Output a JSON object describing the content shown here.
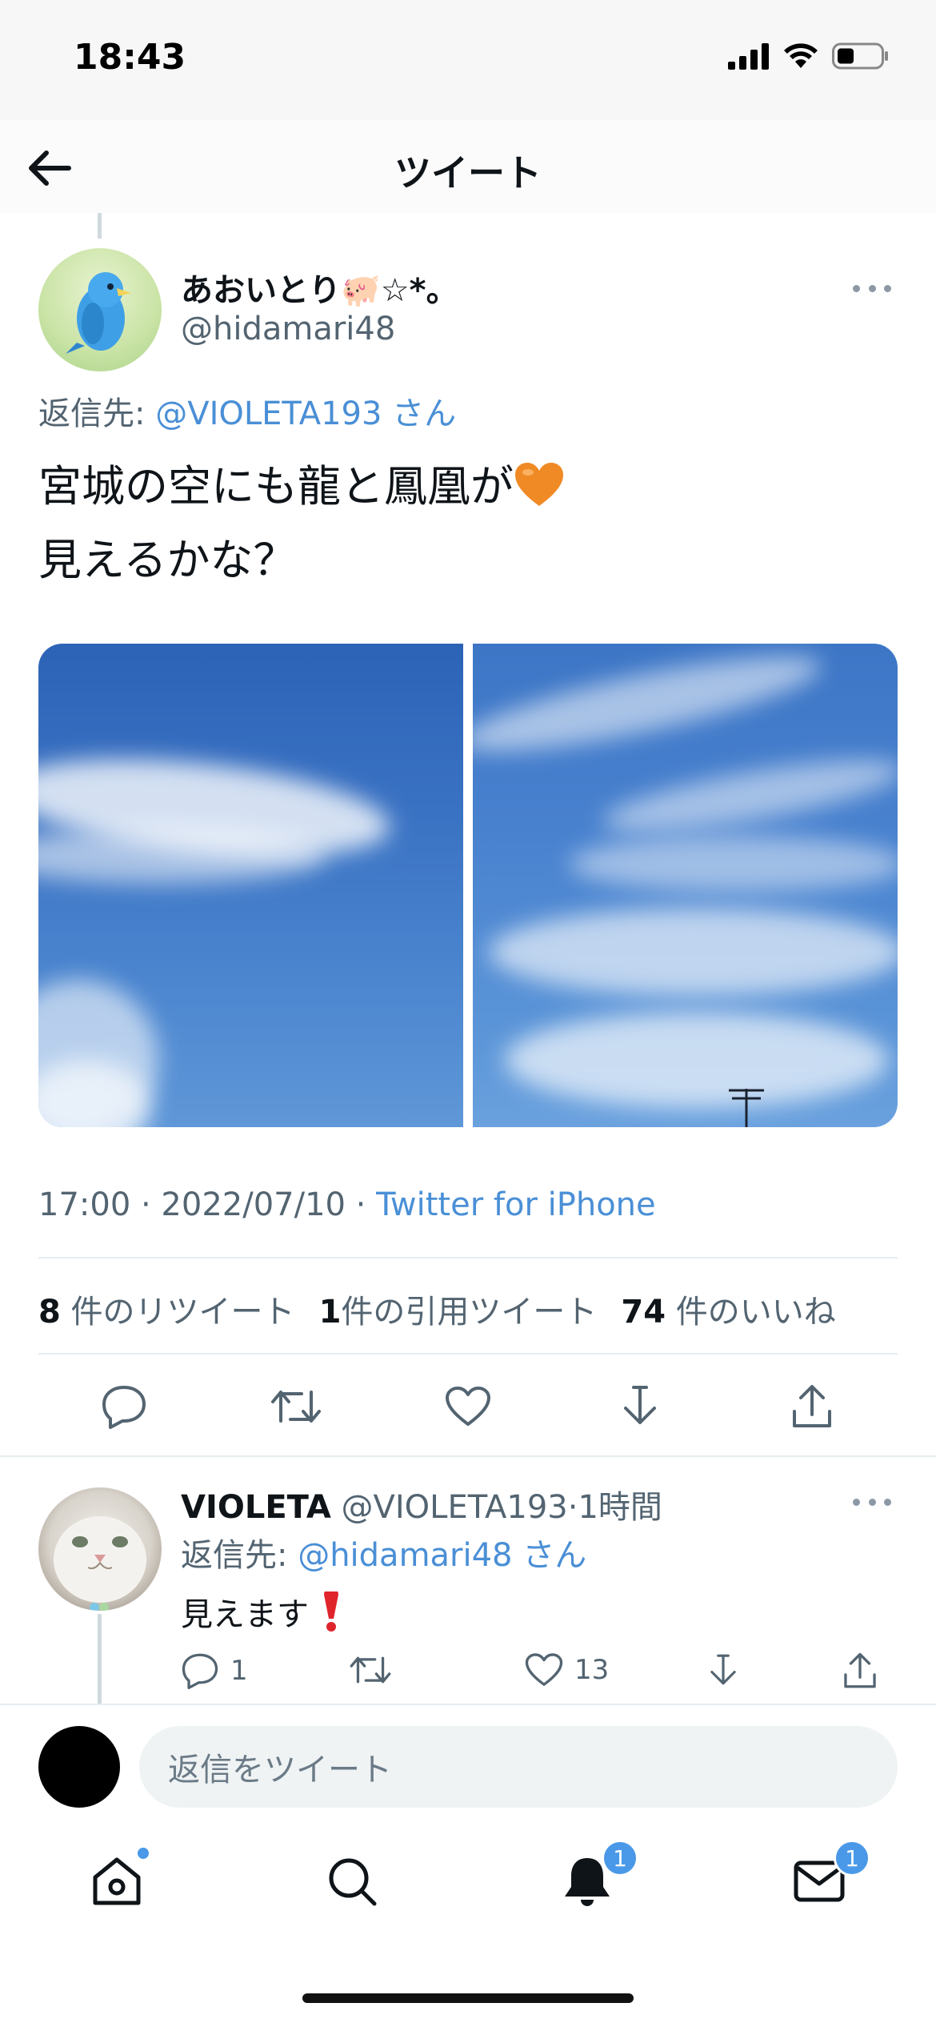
{
  "status_bar": {
    "time": "18:43"
  },
  "header": {
    "title": "ツイート"
  },
  "tweet": {
    "author_name": "あおいとり🐖☆*。",
    "author_handle": "@hidamari48",
    "reply_to_prefix": "返信先: ",
    "reply_to_mention": "@VIOLETA193",
    "reply_to_suffix": " さん",
    "text_line1": "宮城の空にも龍と鳳凰が",
    "text_line2": "見えるかな？",
    "time": "17:00 · 2022/07/10 · ",
    "source": "Twitter for iPhone",
    "retweet_count": "8",
    "retweet_label": " 件のリツイート",
    "quote_count": "1",
    "quote_label": "件の引用ツイート",
    "like_count": "74",
    "like_label": " 件のいいね"
  },
  "reply": {
    "name": "VIOLETA",
    "handle": " @VIOLETA193",
    "time": "·1時間",
    "reply_to_prefix": "返信先: ",
    "reply_to_mention": "@hidamari48",
    "reply_to_suffix": " さん",
    "text": "見えます",
    "reply_count": "1",
    "like_count": "13"
  },
  "compose": {
    "placeholder": "返信をツイート"
  },
  "tab_bar": {
    "notifications_badge": "1",
    "messages_badge": "1"
  },
  "colors": {
    "accent": "#4a8fd6",
    "muted": "#536471",
    "badge": "#4a99e9"
  }
}
